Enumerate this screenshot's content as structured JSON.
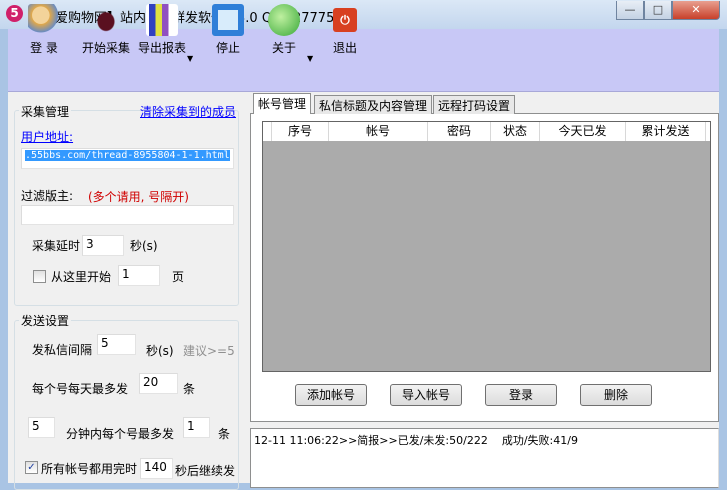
{
  "window": {
    "app_icon": "5",
    "title": "【我爱购物网】站内私信群发软件 V3.0  Q:302777528",
    "minimize": "—",
    "maximize": "□",
    "close": "✕"
  },
  "toolbar": [
    {
      "label": "登 录",
      "icon": "users-icon"
    },
    {
      "label": "开始采集",
      "icon": "bug-icon"
    },
    {
      "label": "导出报表",
      "icon": "chart-icon"
    },
    {
      "label": "停止",
      "icon": "stop-icon"
    },
    {
      "label": "关于",
      "icon": "globe-icon"
    },
    {
      "label": "退出",
      "icon": "power-icon"
    }
  ],
  "collect": {
    "title": "采集管理",
    "clear_link": "清除采集到的成员",
    "url_label": "用户地址:",
    "url_value": ".55bbs.com/thread-8955804-1-1.html",
    "filter_label": "过滤版主:",
    "filter_hint": "(多个请用, 号隔开)",
    "filter_value": "",
    "delay_label": "采集延时",
    "delay_value": "3",
    "delay_unit": "秒(s)",
    "start_here_label": "从这里开始",
    "start_page": "1",
    "page_unit": "页"
  },
  "send": {
    "title": "发送设置",
    "interval_label": "发私信间隔",
    "interval_value": "5",
    "interval_unit": "秒(s)",
    "interval_hint": "建议>=5",
    "daily_label": "每个号每天最多发",
    "daily_value": "20",
    "daily_unit": "条",
    "minutes_value": "5",
    "per_min_label": "分钟内每个号最多发",
    "per_min_value": "1",
    "per_min_unit": "条",
    "all_used_label": "所有帐号都用完时",
    "all_used_value": "140",
    "all_used_suffix": "秒后继续发",
    "all_used_checked": true
  },
  "tabs": [
    "帐号管理",
    "私信标题及内容管理",
    "远程打码设置"
  ],
  "table": {
    "columns": [
      "序号",
      "帐号",
      "密码",
      "状态",
      "今天已发",
      "累计发送"
    ],
    "rows": []
  },
  "buttons": {
    "add": "添加帐号",
    "import": "导入帐号",
    "login": "登录",
    "delete": "删除"
  },
  "log": "12-11 11:06:22>>简报>>已发/未发:50/222    成功/失败:41/9"
}
